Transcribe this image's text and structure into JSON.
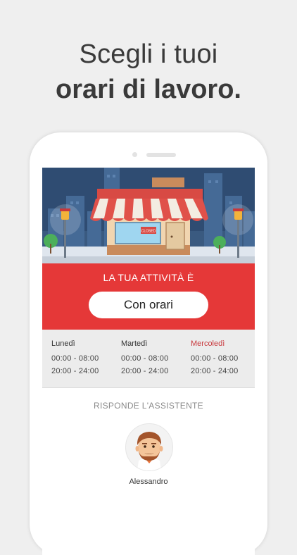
{
  "headline": {
    "line1": "Scegli i tuoi",
    "line2": "orari di lavoro."
  },
  "shop_sign": "CLOSED",
  "banner": {
    "title": "LA TUA ATTIVITÀ È",
    "button_label": "Con orari"
  },
  "schedule": {
    "days": [
      {
        "name": "Lunedì",
        "slots": [
          "00:00 - 08:00",
          "20:00 - 24:00"
        ],
        "highlighted": false
      },
      {
        "name": "Martedì",
        "slots": [
          "00:00 - 08:00",
          "20:00 - 24:00"
        ],
        "highlighted": false
      },
      {
        "name": "Mercoledì",
        "slots": [
          "00:00 - 08:00",
          "20:00 - 24:00"
        ],
        "highlighted": true
      }
    ]
  },
  "assistant": {
    "title": "RISPONDE L'ASSISTENTE",
    "name": "Alessandro",
    "avatar_icon": "man-avatar-icon"
  },
  "colors": {
    "accent_red": "#e53838",
    "day_highlight": "#c8383c",
    "background": "#efefef"
  }
}
